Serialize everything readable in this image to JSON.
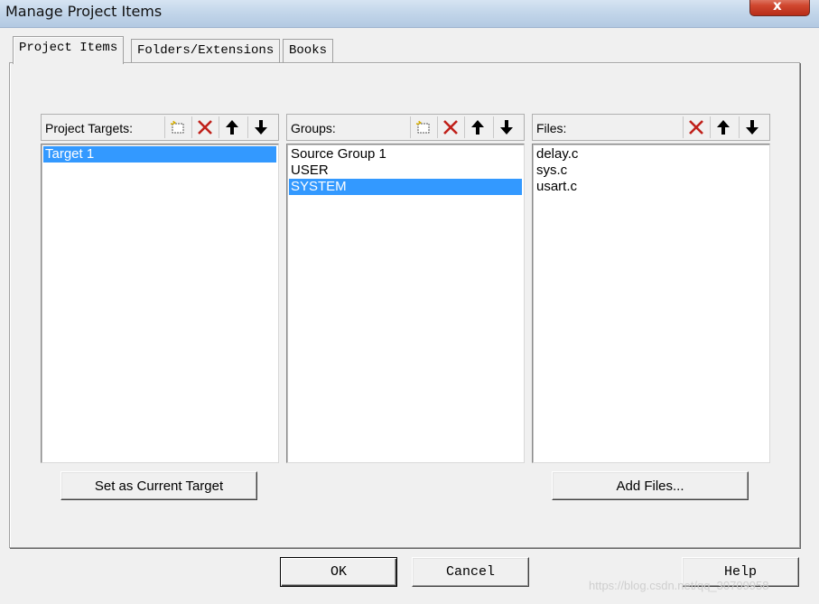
{
  "window": {
    "title": "Manage Project Items",
    "close_label": "x"
  },
  "tabs": [
    {
      "label": "Project Items",
      "active": true
    },
    {
      "label": "Folders/Extensions",
      "active": false
    },
    {
      "label": "Books",
      "active": false
    }
  ],
  "panels": {
    "targets": {
      "label": "Project Targets:",
      "items": [
        {
          "text": "Target 1",
          "selected": true
        }
      ]
    },
    "groups": {
      "label": "Groups:",
      "items": [
        {
          "text": "Source Group 1",
          "selected": false
        },
        {
          "text": "USER",
          "selected": false
        },
        {
          "text": "SYSTEM",
          "selected": true
        }
      ]
    },
    "files": {
      "label": "Files:",
      "items": [
        {
          "text": "delay.c",
          "selected": false
        },
        {
          "text": "sys.c",
          "selected": false
        },
        {
          "text": "usart.c",
          "selected": false
        }
      ]
    }
  },
  "toolbar_icons": [
    "new-item-icon",
    "delete-icon",
    "move-up-icon",
    "move-down-icon"
  ],
  "buttons": {
    "set_current_target": "Set as Current Target",
    "add_files": "Add Files...",
    "ok": "OK",
    "cancel": "Cancel",
    "help": "Help"
  },
  "watermark": "https://blog.csdn.net/qq_30709958",
  "colors": {
    "selection": "#3399ff",
    "delete_icon": "#c0201a",
    "title_bar": "#c3d6ea"
  }
}
